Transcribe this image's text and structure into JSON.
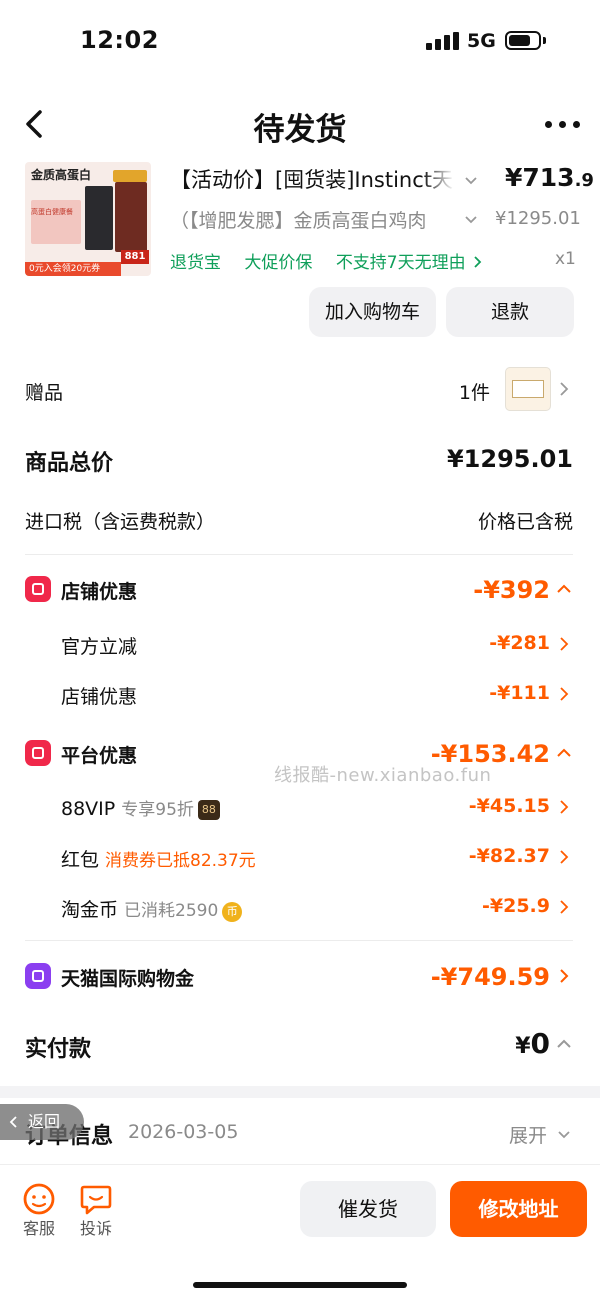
{
  "status_bar": {
    "time": "12:02",
    "network": "5G",
    "battery_level": 0.75
  },
  "nav": {
    "title": "待发货",
    "back_icon": "chevron-left-icon",
    "more_icon": "more-dots-icon"
  },
  "product": {
    "image_texts": {
      "headline": "金质高蛋白",
      "promo_note": "高蛋白健康餐",
      "price_tag": "881",
      "banner": "0元入会领20元券"
    },
    "title": "【活动价】[囤货装]Instinct天",
    "price_int": "¥713",
    "price_dec": ".9",
    "subtitle": "（【增肥发腮】金质高蛋白鸡肉",
    "original_price": "¥1295.01",
    "service_tags": [
      "退货宝",
      "大促价保",
      "不支持7天无理由"
    ],
    "quantity": "x1",
    "buttons": {
      "add_cart": "加入购物车",
      "refund": "退款"
    }
  },
  "gift": {
    "label": "赠品",
    "count": "1件"
  },
  "summary": {
    "total_label": "商品总价",
    "total_value": "¥1295.01",
    "tax_label": "进口税（含运费税款）",
    "tax_value": "价格已含税"
  },
  "store_discount": {
    "label": "店铺优惠",
    "amount": "-¥392",
    "items": [
      {
        "label": "官方立减",
        "amount": "-¥281"
      },
      {
        "label": "店铺优惠",
        "amount": "-¥111"
      }
    ]
  },
  "platform_discount": {
    "label": "平台优惠",
    "amount": "-¥153.42",
    "items": [
      {
        "label": "88VIP",
        "note": "专享95折",
        "badge": "88",
        "amount": "-¥45.15"
      },
      {
        "label": "红包",
        "note": "消费券已抵82.37元",
        "amount": "-¥82.37"
      },
      {
        "label": "淘金币",
        "note": "已消耗2590",
        "coin": "币",
        "amount": "-¥25.9"
      }
    ]
  },
  "tmall_credit": {
    "label": "天猫国际购物金",
    "amount": "-¥749.59"
  },
  "paid": {
    "label": "实付款",
    "currency": "¥",
    "amount": "0"
  },
  "watermark": "线报酷-new.xianbao.fun",
  "order_info": {
    "back_label": "返回",
    "label": "订单信息",
    "date": "2026-03-05",
    "expand": "展开"
  },
  "bottom": {
    "service_label": "客服",
    "complaint_label": "投诉",
    "urge_label": "催发货",
    "modify_label": "修改地址"
  },
  "colors": {
    "accent": "#ff5b00",
    "green": "#0f9f5a",
    "store_icon": "#f0284a",
    "platform_icon": "#f0284a",
    "credit_icon": "#8b3ff0"
  }
}
